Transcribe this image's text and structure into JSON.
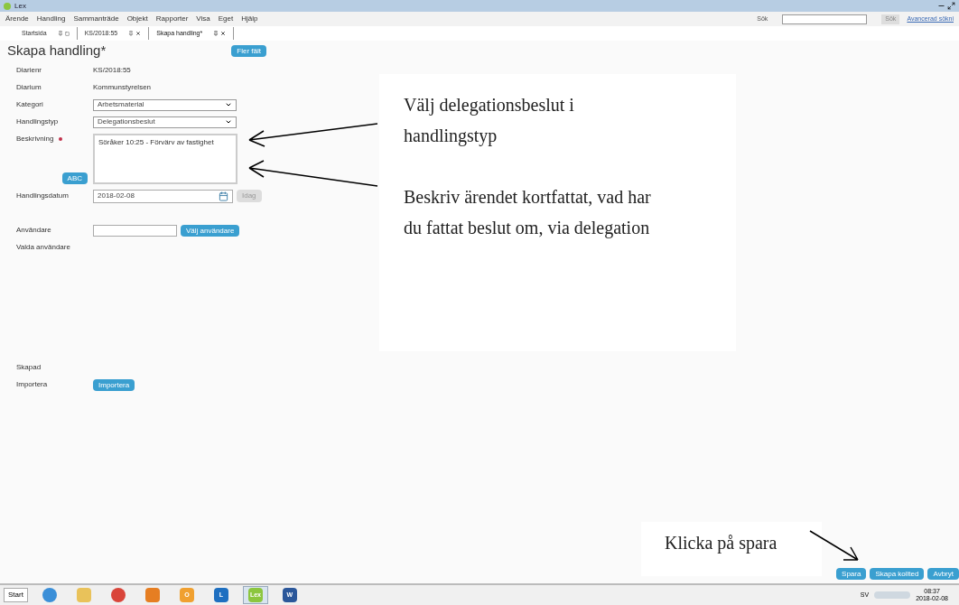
{
  "window": {
    "title": "Lex"
  },
  "menu": [
    "Ärende",
    "Handling",
    "Sammanträde",
    "Objekt",
    "Rapporter",
    "Visa",
    "Eget",
    "Hjälp"
  ],
  "search": {
    "label": "Sök",
    "button": "Sök",
    "link": "Avancerad sökni"
  },
  "tabs": [
    {
      "label": "Startsida",
      "selected": false,
      "closable": false
    },
    {
      "label": "KS/2018:55",
      "selected": false,
      "closable": true
    },
    {
      "label": "Skapa handling*",
      "selected": true,
      "closable": true
    }
  ],
  "form": {
    "title": "Skapa handling*",
    "more_button": "Fler fält",
    "fields": [
      {
        "kind": "text",
        "label": "Diarienr",
        "value": "KS/2018:55"
      },
      {
        "kind": "text",
        "label": "Diarium",
        "value": "Kommunstyrelsen"
      },
      {
        "kind": "select",
        "label": "Kategori",
        "value": "Arbetsmaterial"
      },
      {
        "kind": "select",
        "label": "Handlingstyp",
        "value": "Delegationsbeslut"
      },
      {
        "kind": "textarea",
        "label": "Beskrivning",
        "required": true,
        "value": "Söråker 10:25 - Förvärv av fastighet",
        "button": "ABC"
      },
      {
        "kind": "date",
        "label": "Handlingsdatum",
        "value": "2018-02-08",
        "button": "Idag",
        "disabled": true
      },
      {
        "kind": "user",
        "label": "Användare",
        "button": "Välj användare"
      },
      {
        "kind": "list",
        "label": "Valda användare"
      },
      {
        "kind": "text",
        "label": "Skapad"
      },
      {
        "kind": "button",
        "label": "Importera",
        "button": "Importera"
      }
    ]
  },
  "actions": [
    "Spara",
    "Skapa kollted",
    "Avbryt"
  ],
  "callouts": [
    {
      "text": "Välj delegationsbeslut i handlingstyp"
    },
    {
      "text": "Beskriv ärendet kortfattat, vad har du fattat beslut om, via delegation"
    },
    {
      "text": "Klicka på spara"
    }
  ],
  "taskbar": {
    "start": "Start",
    "apps": [
      {
        "kind": "ie"
      },
      {
        "kind": "folder"
      },
      {
        "kind": "chrome"
      },
      {
        "kind": "media"
      },
      {
        "kind": "outlook",
        "label": "O"
      },
      {
        "kind": "lync",
        "label": "L"
      },
      {
        "kind": "lex",
        "label": "Lex",
        "selected": true
      },
      {
        "kind": "word",
        "label": "W"
      }
    ],
    "language": "SV",
    "time": "08:37",
    "date": "2018-02-08"
  }
}
